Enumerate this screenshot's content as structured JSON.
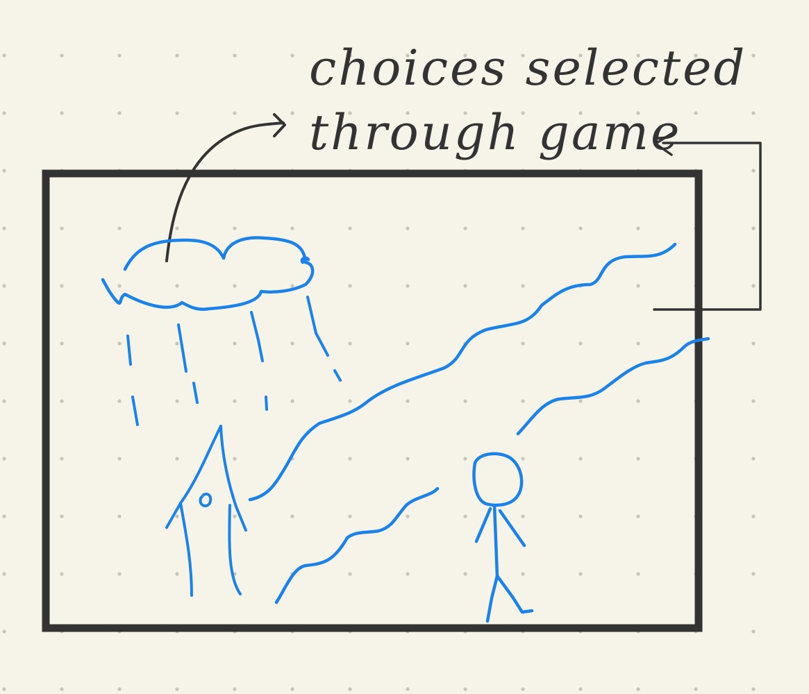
{
  "annotation": {
    "line1": "choices selected",
    "line2": "through game"
  },
  "colors": {
    "paper": "#f6f4e9",
    "dots": "#c7c4b8",
    "ink_dark": "#333333",
    "ink_blue": "#1a82e8"
  },
  "sketch_elements": [
    "cloud",
    "rain",
    "tree",
    "mountain-ridges",
    "stick-figure",
    "game-frame",
    "arrows"
  ]
}
